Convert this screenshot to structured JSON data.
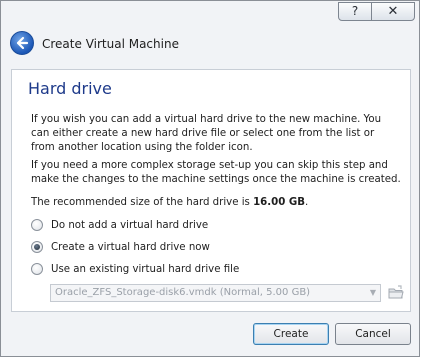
{
  "titlebar": {
    "help_label": "?",
    "close_label": "✕"
  },
  "header": {
    "title": "Create Virtual Machine"
  },
  "page": {
    "heading": "Hard drive",
    "paragraph1": "If you wish you can add a virtual hard drive to the new machine. You can either create a new hard drive file or select one from the list or from another location using the folder icon.",
    "paragraph2": "If you need a more complex storage set-up you can skip this step and make the changes to the machine settings once the machine is created.",
    "recommended_prefix": "The recommended size of the hard drive is ",
    "recommended_size": "16.00 GB",
    "recommended_suffix": "."
  },
  "options": [
    {
      "label": "Do not add a virtual hard drive",
      "checked": false
    },
    {
      "label": "Create a virtual hard drive now",
      "checked": true
    },
    {
      "label": "Use an existing virtual hard drive file",
      "checked": false
    }
  ],
  "existing_file": {
    "value": "Oracle_ZFS_Storage-disk6.vmdk (Normal, 5.00 GB)",
    "enabled": false
  },
  "buttons": {
    "create": "Create",
    "cancel": "Cancel"
  },
  "colors": {
    "heading": "#1e3a8a",
    "accent": "#1c57b6"
  }
}
